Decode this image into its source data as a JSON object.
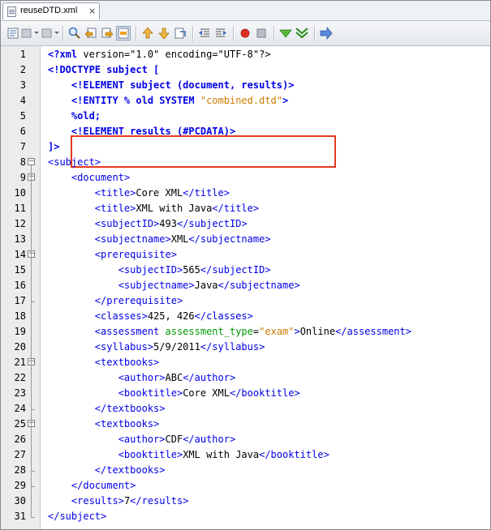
{
  "tab": {
    "title": "reuseDTD.xml",
    "close": "×"
  },
  "toolbar": {
    "icons": [
      "source-view-icon",
      "back-icon",
      "forward-icon",
      "find-icon",
      "find-previous-icon",
      "find-next-icon",
      "toggle-highlight-icon",
      "previous-bookmark-icon",
      "next-bookmark-icon",
      "toggle-bookmark-icon",
      "shift-left-icon",
      "shift-right-icon",
      "record-macro-icon",
      "stop-macro-icon",
      "check-xml-icon",
      "validate-xml-icon",
      "xsl-transform-icon"
    ],
    "accent": "#3c6eb4"
  },
  "colors": {
    "tag": "#0000e6",
    "attribute": "#009900",
    "value": "#ce7b00",
    "highlight_box": "#e23b1f"
  },
  "lines": [
    {
      "n": "1",
      "fold": "",
      "p": [
        [
          "b",
          "<?xml"
        ],
        [
          "",
          " version=\"1.0\" encoding=\"UTF-8\"?>"
        ]
      ]
    },
    {
      "n": "2",
      "fold": "",
      "p": [
        [
          "b",
          "<!DOCTYPE subject ["
        ]
      ]
    },
    {
      "n": "3",
      "fold": "",
      "p": [
        [
          "",
          "    "
        ],
        [
          "b",
          "<!ELEMENT subject (document, results)>"
        ]
      ]
    },
    {
      "n": "4",
      "fold": "",
      "p": [
        [
          "",
          "    "
        ],
        [
          "b",
          "<!ENTITY % old SYSTEM "
        ],
        [
          "val",
          "\"combined.dtd\""
        ],
        [
          "b",
          ">"
        ]
      ]
    },
    {
      "n": "5",
      "fold": "",
      "p": [
        [
          "",
          "    "
        ],
        [
          "b",
          "%old;"
        ]
      ]
    },
    {
      "n": "6",
      "fold": "",
      "p": [
        [
          "",
          "    "
        ],
        [
          "b",
          "<!ELEMENT results (#PCDATA)>"
        ]
      ]
    },
    {
      "n": "7",
      "fold": "",
      "p": [
        [
          "b",
          "]>"
        ]
      ]
    },
    {
      "n": "8",
      "fold": "open",
      "p": [
        [
          "tag",
          "<subject>"
        ]
      ]
    },
    {
      "n": "9",
      "fold": "open",
      "p": [
        [
          "",
          "    "
        ],
        [
          "tag",
          "<document>"
        ]
      ]
    },
    {
      "n": "10",
      "fold": "",
      "p": [
        [
          "",
          "        "
        ],
        [
          "tag",
          "<title>"
        ],
        [
          "",
          "Core XML"
        ],
        [
          "tag",
          "</title>"
        ]
      ]
    },
    {
      "n": "11",
      "fold": "",
      "p": [
        [
          "",
          "        "
        ],
        [
          "tag",
          "<title>"
        ],
        [
          "",
          "XML with Java"
        ],
        [
          "tag",
          "</title>"
        ]
      ]
    },
    {
      "n": "12",
      "fold": "",
      "p": [
        [
          "",
          "        "
        ],
        [
          "tag",
          "<subjectID>"
        ],
        [
          "",
          "493"
        ],
        [
          "tag",
          "</subjectID>"
        ]
      ]
    },
    {
      "n": "13",
      "fold": "",
      "p": [
        [
          "",
          "        "
        ],
        [
          "tag",
          "<subjectname>"
        ],
        [
          "",
          "XML"
        ],
        [
          "tag",
          "</subjectname>"
        ]
      ]
    },
    {
      "n": "14",
      "fold": "open",
      "p": [
        [
          "",
          "        "
        ],
        [
          "tag",
          "<prerequisite>"
        ]
      ]
    },
    {
      "n": "15",
      "fold": "",
      "p": [
        [
          "",
          "            "
        ],
        [
          "tag",
          "<subjectID>"
        ],
        [
          "",
          "565"
        ],
        [
          "tag",
          "</subjectID>"
        ]
      ]
    },
    {
      "n": "16",
      "fold": "",
      "p": [
        [
          "",
          "            "
        ],
        [
          "tag",
          "<subjectname>"
        ],
        [
          "",
          "Java"
        ],
        [
          "tag",
          "</subjectname>"
        ]
      ]
    },
    {
      "n": "17",
      "fold": "end",
      "p": [
        [
          "",
          "        "
        ],
        [
          "tag",
          "</prerequisite>"
        ]
      ]
    },
    {
      "n": "18",
      "fold": "",
      "p": [
        [
          "",
          "        "
        ],
        [
          "tag",
          "<classes>"
        ],
        [
          "",
          "425, 426"
        ],
        [
          "tag",
          "</classes>"
        ]
      ]
    },
    {
      "n": "19",
      "fold": "",
      "p": [
        [
          "",
          "        "
        ],
        [
          "tag",
          "<assessment "
        ],
        [
          "attr",
          "assessment_type"
        ],
        [
          "",
          "="
        ],
        [
          "val",
          "\"exam\""
        ],
        [
          "tag",
          ">"
        ],
        [
          "",
          "Online"
        ],
        [
          "tag",
          "</assessment>"
        ]
      ]
    },
    {
      "n": "20",
      "fold": "",
      "p": [
        [
          "",
          "        "
        ],
        [
          "tag",
          "<syllabus>"
        ],
        [
          "",
          "5/9/2011"
        ],
        [
          "tag",
          "</syllabus>"
        ]
      ]
    },
    {
      "n": "21",
      "fold": "open",
      "p": [
        [
          "",
          "        "
        ],
        [
          "tag",
          "<textbooks>"
        ]
      ]
    },
    {
      "n": "22",
      "fold": "",
      "p": [
        [
          "",
          "            "
        ],
        [
          "tag",
          "<author>"
        ],
        [
          "",
          "ABC"
        ],
        [
          "tag",
          "</author>"
        ]
      ]
    },
    {
      "n": "23",
      "fold": "",
      "p": [
        [
          "",
          "            "
        ],
        [
          "tag",
          "<booktitle>"
        ],
        [
          "",
          "Core XML"
        ],
        [
          "tag",
          "</booktitle>"
        ]
      ]
    },
    {
      "n": "24",
      "fold": "end",
      "p": [
        [
          "",
          "        "
        ],
        [
          "tag",
          "</textbooks>"
        ]
      ]
    },
    {
      "n": "25",
      "fold": "open",
      "p": [
        [
          "",
          "        "
        ],
        [
          "tag",
          "<textbooks>"
        ]
      ]
    },
    {
      "n": "26",
      "fold": "",
      "p": [
        [
          "",
          "            "
        ],
        [
          "tag",
          "<author>"
        ],
        [
          "",
          "CDF"
        ],
        [
          "tag",
          "</author>"
        ]
      ]
    },
    {
      "n": "27",
      "fold": "",
      "p": [
        [
          "",
          "            "
        ],
        [
          "tag",
          "<booktitle>"
        ],
        [
          "",
          "XML with Java"
        ],
        [
          "tag",
          "</booktitle>"
        ]
      ]
    },
    {
      "n": "28",
      "fold": "end",
      "p": [
        [
          "",
          "        "
        ],
        [
          "tag",
          "</textbooks>"
        ]
      ]
    },
    {
      "n": "29",
      "fold": "end",
      "p": [
        [
          "",
          "    "
        ],
        [
          "tag",
          "</document>"
        ]
      ]
    },
    {
      "n": "30",
      "fold": "",
      "p": [
        [
          "",
          "    "
        ],
        [
          "tag",
          "<results>"
        ],
        [
          "",
          "7"
        ],
        [
          "tag",
          "</results>"
        ]
      ]
    },
    {
      "n": "31",
      "fold": "end",
      "p": [
        [
          "tag",
          "</subject>"
        ]
      ]
    }
  ]
}
